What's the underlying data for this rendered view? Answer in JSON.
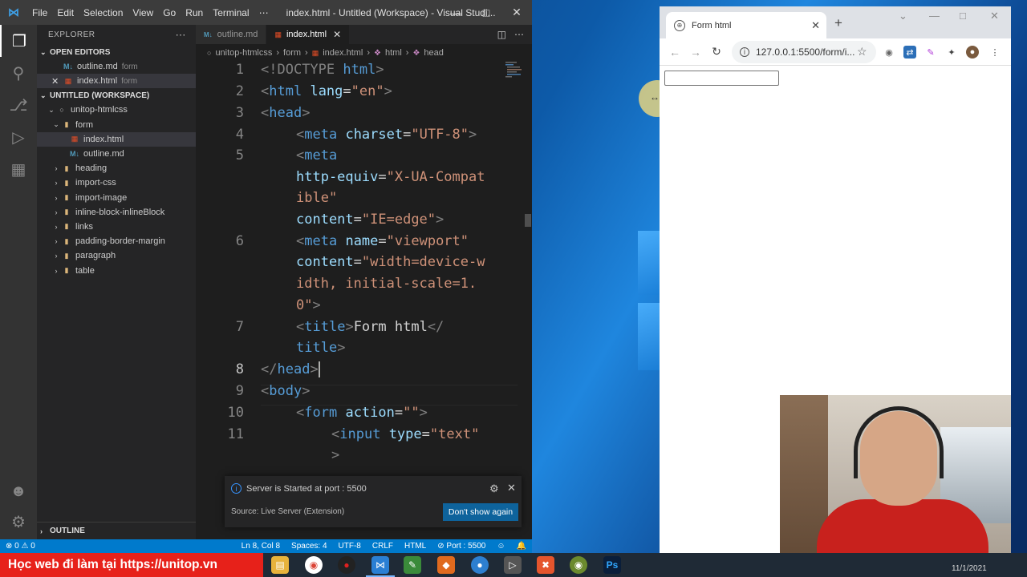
{
  "vscode": {
    "menu": [
      "File",
      "Edit",
      "Selection",
      "View",
      "Go",
      "Run",
      "Terminal",
      "⋯"
    ],
    "window_title": "index.html - Untitled (Workspace) - Visual Studi...",
    "explorer": {
      "header": "EXPLORER",
      "open_editors_label": "OPEN EDITORS",
      "open_editors": [
        {
          "name": "outline.md",
          "desc": "form",
          "type": "md"
        },
        {
          "name": "index.html",
          "desc": "form",
          "type": "html"
        }
      ],
      "workspace_label": "UNTITLED (WORKSPACE)",
      "root_folder": "unitop-htmlcss",
      "form_folder": "form",
      "form_files": [
        {
          "name": "index.html",
          "type": "html"
        },
        {
          "name": "outline.md",
          "type": "md"
        }
      ],
      "folders": [
        "heading",
        "import-css",
        "import-image",
        "inline-block-inlineBlock",
        "links",
        "padding-border-margin",
        "paragraph",
        "table"
      ],
      "outline_label": "OUTLINE"
    },
    "tabs": [
      {
        "label": "outline.md",
        "type": "md"
      },
      {
        "label": "index.html",
        "type": "html"
      }
    ],
    "breadcrumb": [
      "unitop-htmlcss",
      "form",
      "index.html",
      "html",
      "head"
    ],
    "line_numbers": [
      "1",
      "2",
      "3",
      "4",
      "5",
      "6",
      "7",
      "8",
      "9",
      "10",
      "11"
    ],
    "code": {
      "l1_kw": "!DOCTYPE",
      "l1_tag": "html",
      "l2_tag": "html",
      "l2_attr": "lang",
      "l2_val": "\"en\"",
      "l3_tag": "head",
      "l4_tag": "meta",
      "l4_attr": "charset",
      "l4_val": "\"UTF-8\"",
      "l5_tag": "meta",
      "l5b_attr": "http-equiv",
      "l5b_val": "\"X-UA-Compat",
      "l5c_val": "ible\"",
      "l5d_attr": "content",
      "l5d_val": "\"IE=edge\"",
      "l6_tag": "meta",
      "l6_attr": "name",
      "l6_val": "\"viewport\"",
      "l6b_attr": "content",
      "l6b_val": "\"width=device-w",
      "l6c_val": "idth, initial-scale=1.",
      "l6d_val": "0\"",
      "l7_tag": "title",
      "l7_text": "Form html",
      "l7b_tag": "title",
      "l8_tag": "head",
      "l9_tag": "body",
      "l10_tag": "form",
      "l10_attr": "action",
      "l10_val": "\"\"",
      "l11_tag": "input",
      "l11_attr": "type",
      "l11_val": "\"text\""
    },
    "notification": {
      "message": "Server is Started at port : 5500",
      "source": "Source: Live Server (Extension)",
      "button": "Don't show again"
    },
    "status": {
      "errors": "0",
      "warnings": "0",
      "position": "Ln 8, Col 8",
      "spaces": "Spaces: 4",
      "encoding": "UTF-8",
      "eol": "CRLF",
      "language": "HTML",
      "port": "Port : 5500"
    }
  },
  "chrome": {
    "tab_title": "Form html",
    "url": "127.0.0.1:5500/form/i..."
  },
  "taskbar": {
    "banner": "Học web đi làm tại https://unitop.vn",
    "clock": "11/1/2021"
  }
}
